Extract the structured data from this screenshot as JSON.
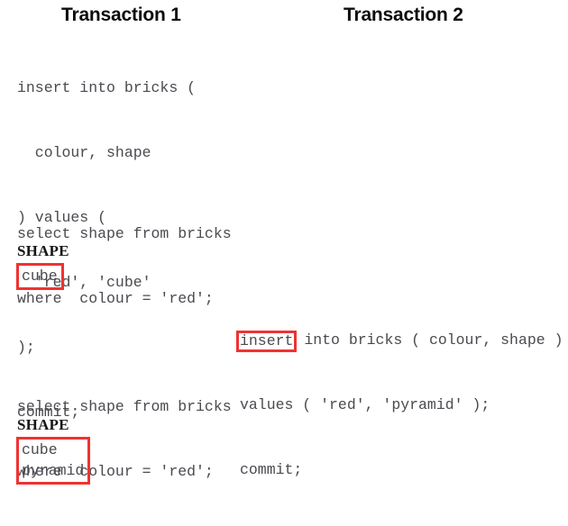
{
  "headings": {
    "transaction_1": "Transaction 1",
    "transaction_2": "Transaction 2"
  },
  "colors": {
    "highlight_red": "#f03232",
    "code_text": "#4a4a50",
    "heading_text": "#0d0d0d",
    "background": "#ffffff"
  },
  "transaction_1": {
    "insert_statement": {
      "lines": [
        "insert into bricks (",
        "  colour, shape",
        ") values (",
        "  'red', 'cube'",
        ");",
        "commit;"
      ]
    },
    "select_statement_first": {
      "lines": [
        "select shape from bricks",
        "where  colour = 'red';"
      ]
    },
    "result_first": {
      "column_header": "SHAPE",
      "rows": [
        "cube"
      ]
    },
    "select_statement_second": {
      "lines": [
        "select shape from bricks",
        "where  colour = 'red';"
      ]
    },
    "result_second": {
      "column_header": "SHAPE",
      "rows": [
        "cube",
        "pyramid"
      ]
    }
  },
  "transaction_2": {
    "insert_statement": {
      "highlighted_keyword": "insert",
      "line1_rest": " into bricks ( colour, shape )",
      "lines_rest": [
        "values ( 'red', 'pyramid' );",
        "commit;"
      ]
    }
  }
}
